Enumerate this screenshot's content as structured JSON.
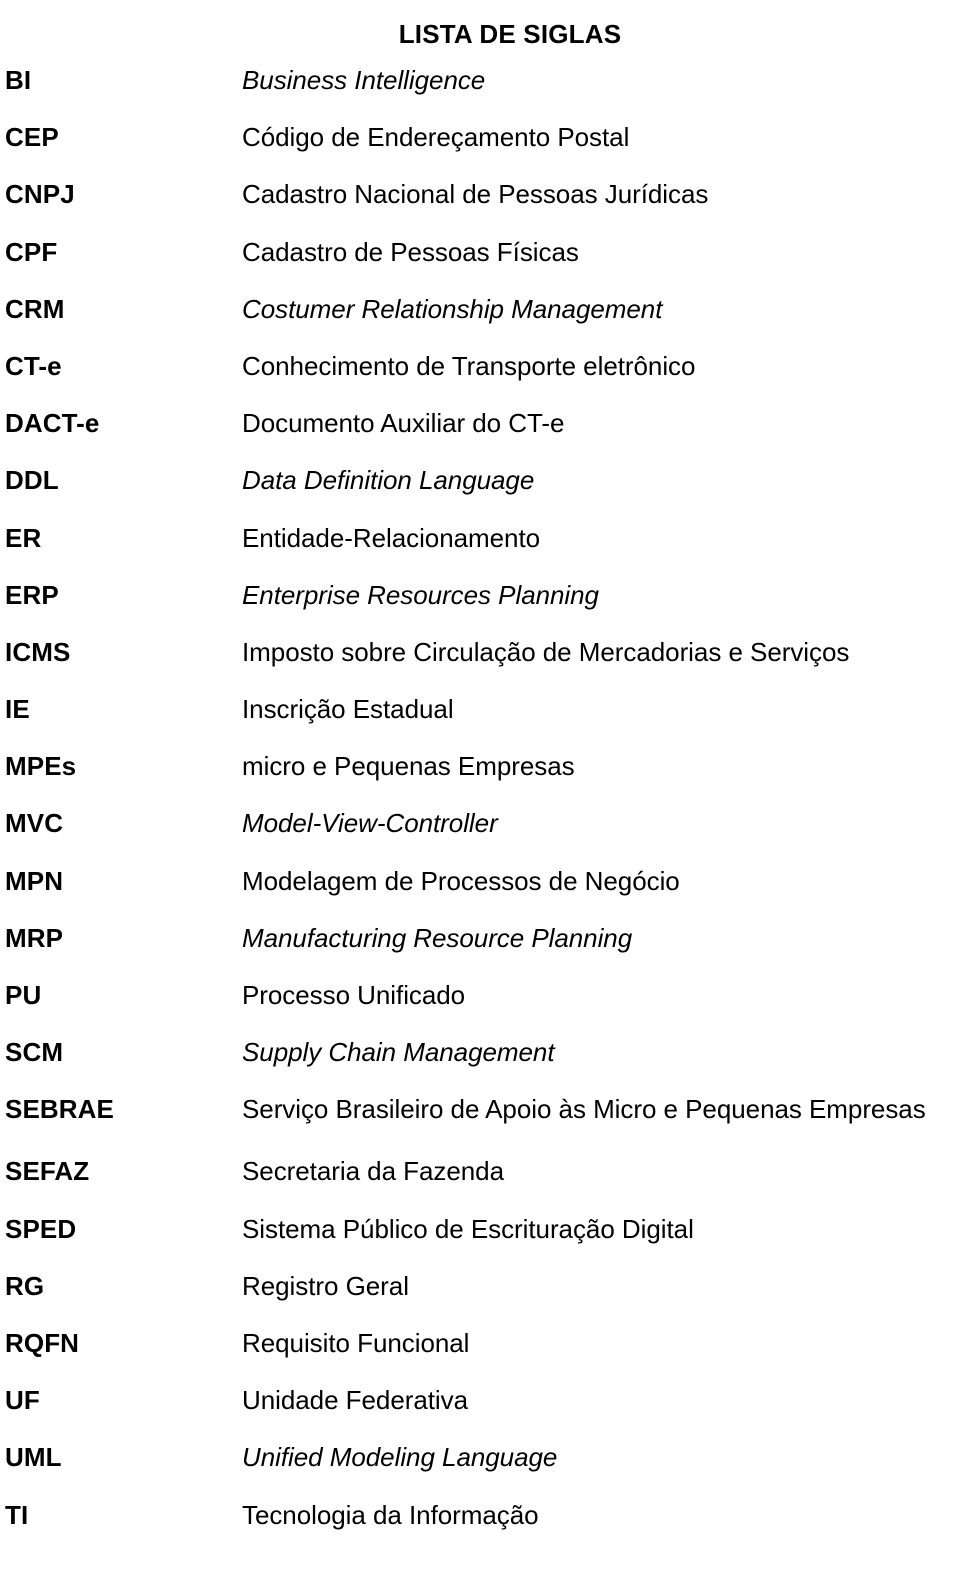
{
  "document": {
    "title": "LISTA DE SIGLAS",
    "entries": [
      {
        "term": "BI",
        "definition": "Business Intelligence",
        "italic": true
      },
      {
        "term": "CEP",
        "definition": "Código de Endereçamento Postal",
        "italic": false
      },
      {
        "term": "CNPJ",
        "definition": "Cadastro Nacional de Pessoas Jurídicas",
        "italic": false
      },
      {
        "term": "CPF",
        "definition": "Cadastro de Pessoas Físicas",
        "italic": false
      },
      {
        "term": "CRM",
        "definition": "Costumer Relationship Management",
        "italic": true
      },
      {
        "term": "CT-e",
        "definition": "Conhecimento de Transporte eletrônico",
        "italic": false
      },
      {
        "term": "DACT-e",
        "definition": "Documento Auxiliar do CT-e",
        "italic": false
      },
      {
        "term": "DDL",
        "definition": "Data Definition Language",
        "italic": true
      },
      {
        "term": "ER",
        "definition": "Entidade-Relacionamento",
        "italic": false
      },
      {
        "term": "ERP",
        "definition": "Enterprise Resources Planning",
        "italic": true
      },
      {
        "term": "ICMS",
        "definition": "Imposto sobre Circulação de Mercadorias e Serviços",
        "italic": false
      },
      {
        "term": "IE",
        "definition": "Inscrição Estadual",
        "italic": false
      },
      {
        "term": "MPEs",
        "definition": "micro e Pequenas Empresas",
        "italic": false
      },
      {
        "term": "MVC",
        "definition": "Model-View-Controller",
        "italic": true
      },
      {
        "term": "MPN",
        "definition": "Modelagem de Processos de Negócio",
        "italic": false
      },
      {
        "term": "MRP",
        "definition": "Manufacturing Resource Planning",
        "italic": true
      },
      {
        "term": "PU",
        "definition": "Processo Unificado",
        "italic": false
      },
      {
        "term": "SCM",
        "definition": "Supply Chain Management",
        "italic": true
      },
      {
        "term": "SEBRAE",
        "definition": "Serviço Brasileiro de Apoio às Micro e Pequenas Empresas",
        "italic": false
      },
      {
        "term": "SEFAZ",
        "definition": "Secretaria da Fazenda",
        "italic": false
      },
      {
        "term": "SPED",
        "definition": "Sistema Público de Escrituração Digital",
        "italic": false
      },
      {
        "term": "RG",
        "definition": "Registro Geral",
        "italic": false
      },
      {
        "term": "RQFN",
        "definition": "Requisito Funcional",
        "italic": false
      },
      {
        "term": "UF",
        "definition": "Unidade Federativa",
        "italic": false
      },
      {
        "term": "UML",
        "definition": "Unified Modeling Language",
        "italic": true
      },
      {
        "term": "TI",
        "definition": "Tecnologia da Informação",
        "italic": false
      }
    ]
  }
}
